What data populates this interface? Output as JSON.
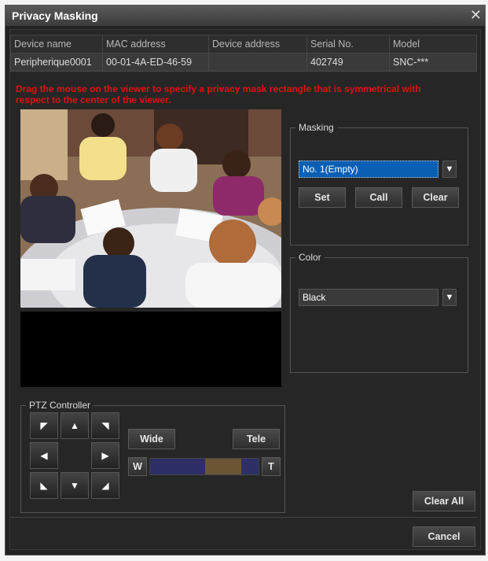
{
  "window": {
    "title": "Privacy Masking",
    "close_glyph": "✕"
  },
  "device_table": {
    "headers": [
      "Device name",
      "MAC address",
      "Device address",
      "Serial No.",
      "Model"
    ],
    "row": [
      "Peripherique0001",
      "00-01-4A-ED-46-59",
      "",
      "402749",
      "SNC-***"
    ]
  },
  "instruction": "Drag the mouse on the viewer to specify a privacy mask rectangle that is symmetrical with respect to the center of the viewer.",
  "masking": {
    "legend": "Masking",
    "selected": "No. 1(Empty)",
    "set_label": "Set",
    "call_label": "Call",
    "clear_label": "Clear"
  },
  "color": {
    "legend": "Color",
    "selected": "Black"
  },
  "ptz": {
    "legend": "PTZ Controller",
    "wide_label": "Wide",
    "tele_label": "Tele",
    "w_label": "W",
    "t_label": "T",
    "zoom_level": 0.76
  },
  "buttons": {
    "clear_all": "Clear All",
    "cancel": "Cancel"
  },
  "colors": {
    "accent": "#0a5fb4",
    "warning": "#e01010",
    "zoom_bar": "#2d2f66",
    "zoom_marker": "#6b5535"
  }
}
